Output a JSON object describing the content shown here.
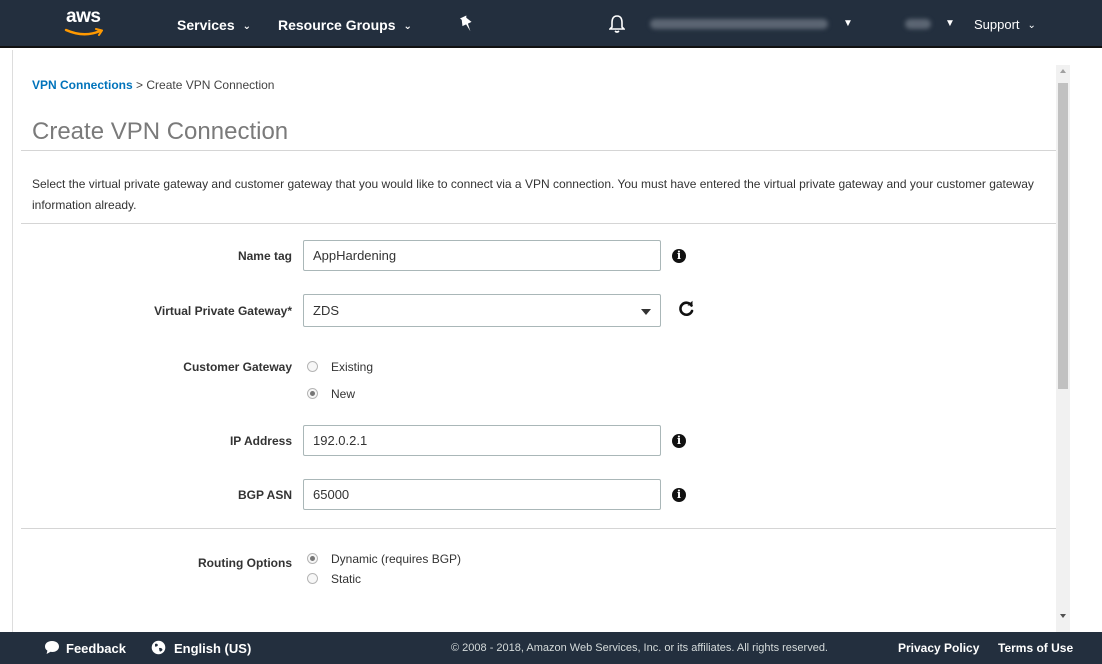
{
  "nav": {
    "logo": "aws",
    "services": "Services",
    "resource_groups": "Resource Groups",
    "support": "Support"
  },
  "breadcrumb": {
    "link": "VPN Connections",
    "separator": ">",
    "current": "Create VPN Connection"
  },
  "page": {
    "title": "Create VPN Connection",
    "description": "Select the virtual private gateway and customer gateway that you would like to connect via a VPN connection. You must have entered the virtual private gateway and your customer gateway information already."
  },
  "form": {
    "name_tag": {
      "label": "Name tag",
      "value": "AppHardening"
    },
    "vpg": {
      "label": "Virtual Private Gateway*",
      "value": "ZDS"
    },
    "customer_gateway": {
      "label": "Customer Gateway",
      "options": [
        "Existing",
        "New"
      ],
      "selected": "New"
    },
    "ip_address": {
      "label": "IP Address",
      "value": "192.0.2.1"
    },
    "bgp_asn": {
      "label": "BGP ASN",
      "value": "65000"
    },
    "routing": {
      "label": "Routing Options",
      "options": [
        "Dynamic (requires BGP)",
        "Static"
      ],
      "selected": "Dynamic (requires BGP)"
    }
  },
  "footer": {
    "feedback": "Feedback",
    "language": "English (US)",
    "copyright": "© 2008 - 2018, Amazon Web Services, Inc. or its affiliates. All rights reserved.",
    "privacy": "Privacy Policy",
    "terms": "Terms of Use"
  },
  "colors": {
    "nav_bg": "#232f3e",
    "link": "#0073bb"
  }
}
